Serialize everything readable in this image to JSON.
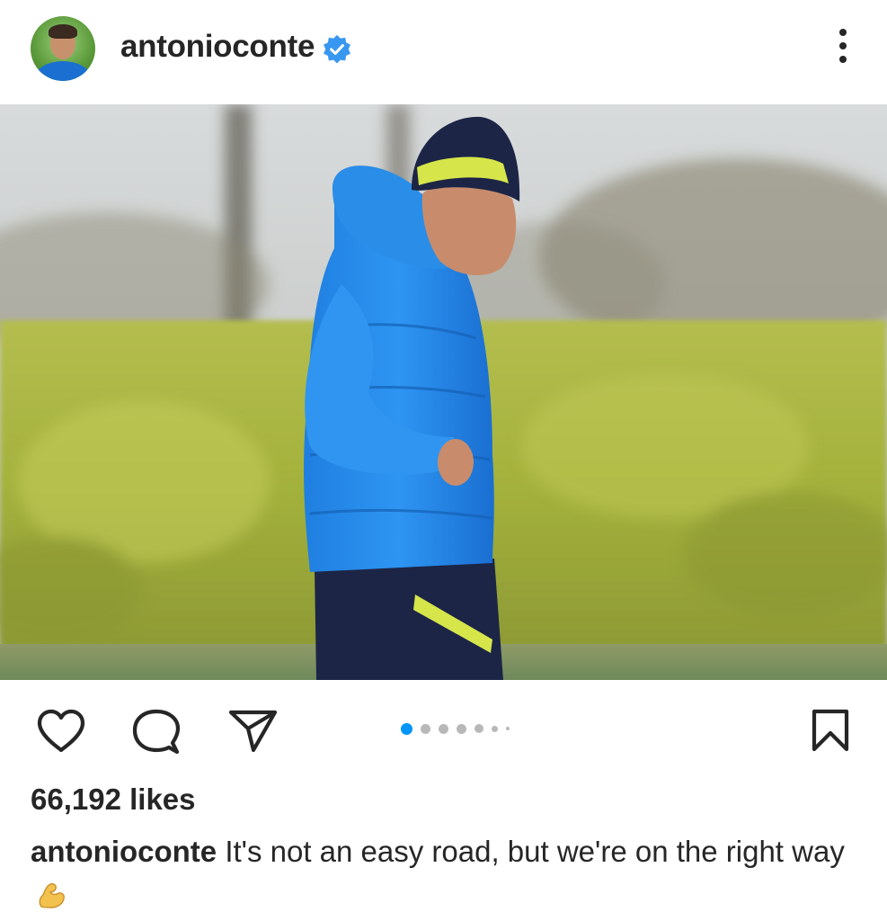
{
  "post": {
    "username": "antonioconte",
    "verified": true,
    "likes": "66,192 likes",
    "caption_user": "antonioconte",
    "caption_text": "It's not an easy road, but we're on the right way",
    "caption_emoji": "flexed-biceps-emoji",
    "carousel": {
      "count": 7,
      "active_index": 0
    }
  },
  "icons": {
    "verified": "verified-badge-icon",
    "more": "more-options-icon",
    "like": "heart-icon",
    "comment": "comment-icon",
    "share": "send-icon",
    "save": "bookmark-icon"
  },
  "colors": {
    "text": "#262626",
    "verified_blue": "#3897f0",
    "carousel_active": "#0095f6",
    "carousel_inactive": "#b8b8b8"
  }
}
